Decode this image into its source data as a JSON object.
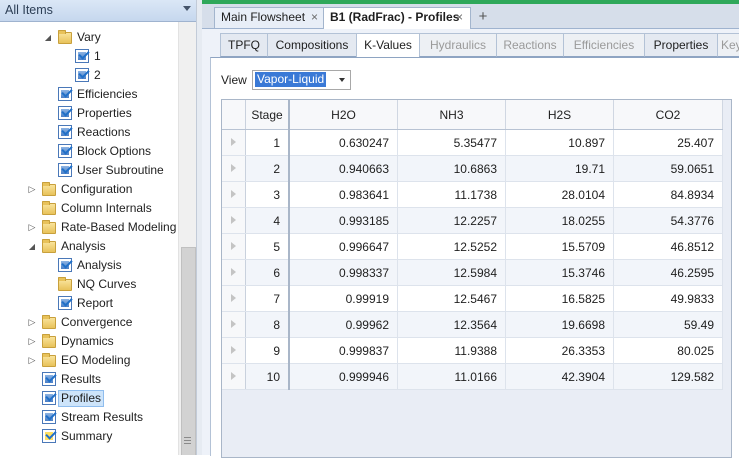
{
  "nav": {
    "header": "All Items",
    "tree": [
      {
        "label": "Vary",
        "icon": "folder-open-icon",
        "expand": "collapse",
        "indent": 4
      },
      {
        "label": "1",
        "icon": "checked-form-icon",
        "expand": "",
        "indent": 5
      },
      {
        "label": "2",
        "icon": "checked-form-icon",
        "expand": "",
        "indent": 5
      },
      {
        "label": "Efficiencies",
        "icon": "checked-form-icon",
        "expand": "",
        "indent": 4
      },
      {
        "label": "Properties",
        "icon": "checked-form-icon",
        "expand": "",
        "indent": 4
      },
      {
        "label": "Reactions",
        "icon": "checked-form-icon",
        "expand": "",
        "indent": 4
      },
      {
        "label": "Block Options",
        "icon": "checked-form-icon",
        "expand": "",
        "indent": 4
      },
      {
        "label": "User Subroutine",
        "icon": "checked-form-icon",
        "expand": "",
        "indent": 4
      },
      {
        "label": "Configuration",
        "icon": "folder-icon",
        "expand": "expand",
        "indent": 3
      },
      {
        "label": "Column Internals",
        "icon": "folder-icon",
        "expand": "",
        "indent": 3
      },
      {
        "label": "Rate-Based Modeling",
        "icon": "folder-icon",
        "expand": "expand",
        "indent": 3
      },
      {
        "label": "Analysis",
        "icon": "folder-open-icon",
        "expand": "collapse",
        "indent": 3
      },
      {
        "label": "Analysis",
        "icon": "checked-form-icon",
        "expand": "",
        "indent": 4
      },
      {
        "label": "NQ Curves",
        "icon": "folder-icon",
        "expand": "",
        "indent": 4
      },
      {
        "label": "Report",
        "icon": "checked-form-icon",
        "expand": "",
        "indent": 4
      },
      {
        "label": "Convergence",
        "icon": "folder-icon",
        "expand": "expand",
        "indent": 3
      },
      {
        "label": "Dynamics",
        "icon": "folder-icon",
        "expand": "expand",
        "indent": 3
      },
      {
        "label": "EO Modeling",
        "icon": "folder-icon",
        "expand": "expand",
        "indent": 3
      },
      {
        "label": "Results",
        "icon": "checked-form-icon",
        "expand": "",
        "indent": 3
      },
      {
        "label": "Profiles",
        "icon": "checked-form-icon",
        "expand": "",
        "indent": 3,
        "selected": true
      },
      {
        "label": "Stream Results",
        "icon": "checked-form-icon",
        "expand": "",
        "indent": 3
      },
      {
        "label": "Summary",
        "icon": "checked-item-icon",
        "expand": "",
        "indent": 3
      }
    ]
  },
  "doc_tabs": [
    {
      "label": "Main Flowsheet",
      "close": "×",
      "active": false
    },
    {
      "label": "B1 (RadFrac) - Profiles",
      "close": "×",
      "active": true
    }
  ],
  "new_tab": "+",
  "sub_tabs": [
    {
      "label": "TPFQ",
      "state": "normal"
    },
    {
      "label": "Compositions",
      "state": "normal"
    },
    {
      "label": "K-Values",
      "state": "active"
    },
    {
      "label": "Hydraulics",
      "state": "disabled"
    },
    {
      "label": "Reactions",
      "state": "disabled"
    },
    {
      "label": "Efficiencies",
      "state": "disabled"
    },
    {
      "label": "Properties",
      "state": "normal"
    },
    {
      "label": "Key",
      "state": "disabled"
    }
  ],
  "view": {
    "label": "View",
    "value": "Vapor-Liquid"
  },
  "table": {
    "columns": [
      "Stage",
      "H2O",
      "NH3",
      "H2S",
      "CO2"
    ],
    "rows": [
      [
        "1",
        "0.630247",
        "5.35477",
        "10.897",
        "25.407"
      ],
      [
        "2",
        "0.940663",
        "10.6863",
        "19.71",
        "59.0651"
      ],
      [
        "3",
        "0.983641",
        "11.1738",
        "28.0104",
        "84.8934"
      ],
      [
        "4",
        "0.993185",
        "12.2257",
        "18.0255",
        "54.3776"
      ],
      [
        "5",
        "0.996647",
        "12.5252",
        "15.5709",
        "46.8512"
      ],
      [
        "6",
        "0.998337",
        "12.5984",
        "15.3746",
        "46.2595"
      ],
      [
        "7",
        "0.99919",
        "12.5467",
        "16.5825",
        "49.9833"
      ],
      [
        "8",
        "0.99962",
        "12.3564",
        "19.6698",
        "59.49"
      ],
      [
        "9",
        "0.999837",
        "11.9388",
        "26.3353",
        "80.025"
      ],
      [
        "10",
        "0.999946",
        "11.0166",
        "42.3904",
        "129.582"
      ]
    ]
  }
}
